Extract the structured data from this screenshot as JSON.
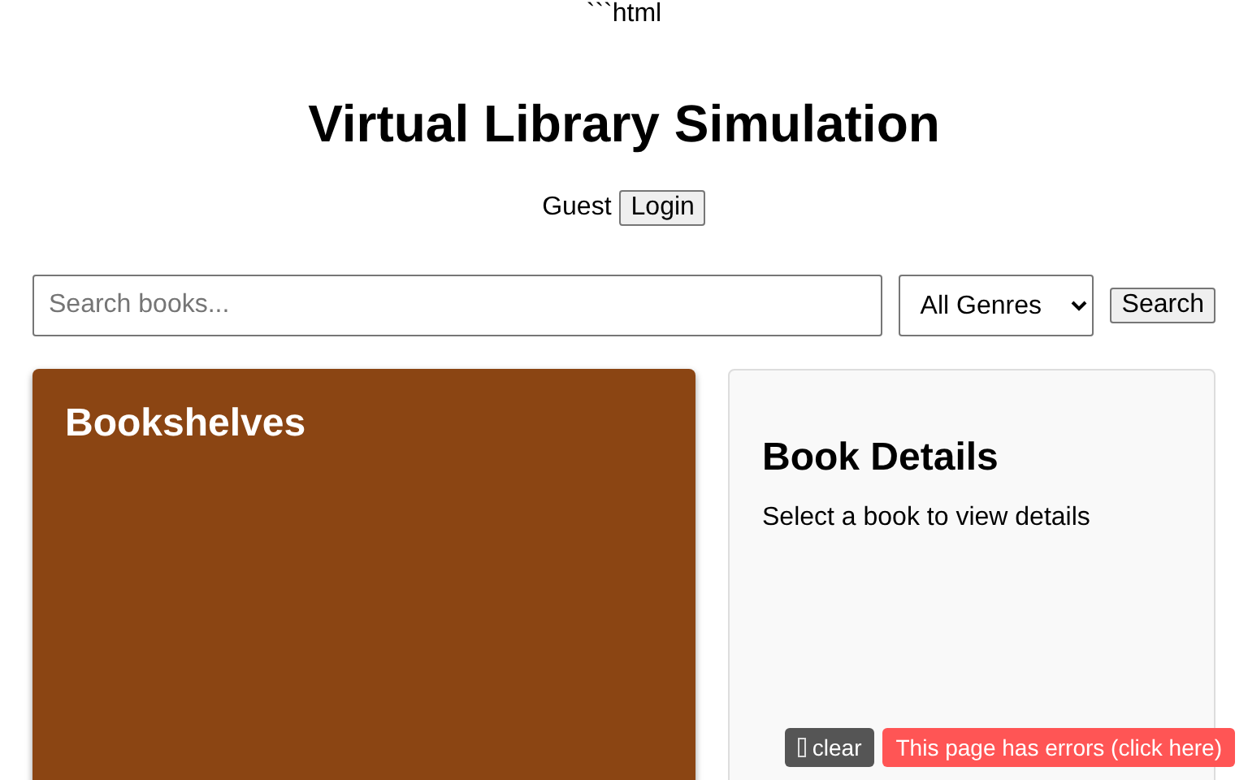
{
  "stray_text": "```html",
  "title": "Virtual Library Simulation",
  "user": {
    "status": "Guest",
    "login_button": "Login"
  },
  "search": {
    "placeholder": "Search books...",
    "genre": "All Genres",
    "button": "Search"
  },
  "bookshelves": {
    "title": "Bookshelves"
  },
  "details": {
    "title": "Book Details",
    "message": "Select a book to view details"
  },
  "error_bar": {
    "clear": "clear",
    "message": "This page has errors (click here)"
  }
}
